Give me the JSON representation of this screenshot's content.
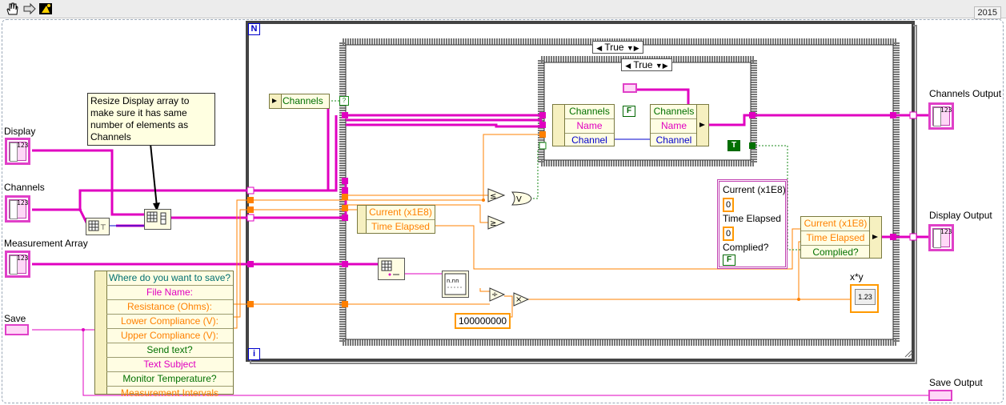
{
  "version": "2015",
  "toolbar": {
    "hand_icon": "hand-icon",
    "arrow_icon": "run-arrow-icon",
    "highlight_icon": "highlight-icon"
  },
  "colors": {
    "pink": "#e000c0",
    "orange": "#ff8000",
    "green": "#007000",
    "blue": "#0000cc",
    "loop_border": "#333333"
  },
  "inputs": {
    "display": "Display",
    "channels": "Channels",
    "measurement_array": "Measurement Array",
    "save": "Save"
  },
  "outputs": {
    "channels_output": "Channels Output",
    "display_output": "Display Output",
    "save_output": "Save Output"
  },
  "note": "Resize Display array to make sure it has same number of elements as Channels",
  "for_loop": {
    "count_label": "N",
    "index_label": "i"
  },
  "case_outer": {
    "selector": "True"
  },
  "case_inner": {
    "selector": "True"
  },
  "channels_unbundle": "Channels",
  "left_cluster": [
    "Where do you want to save?",
    "File Name:",
    "Resistance (Ohms):",
    "Lower Compliance (V):",
    "Upper Compliance (V):",
    "Send text?",
    "Text Subject",
    "Monitor Temperature?",
    "Measurement Intervals"
  ],
  "current_unbundle": [
    "Current (x1E8)",
    "Time Elapsed"
  ],
  "inner_left_bundle": [
    "Channels",
    "Name",
    "Channel"
  ],
  "inner_right_bundle": [
    "Channels",
    "Name",
    "Channel"
  ],
  "bool_f": "F",
  "bool_t": "T",
  "cluster_const": {
    "current_label": "Current (x1E8)",
    "current_value": "0",
    "time_label": "Time Elapsed",
    "time_value": "0",
    "complied_label": "Complied?",
    "complied_value": "F"
  },
  "right_bundle": [
    "Current (x1E8)",
    "Time Elapsed",
    "Complied?"
  ],
  "constant_100m": "100000000",
  "xy_label": "x*y",
  "xy_indicator": "1.23",
  "num_indicator": "123"
}
